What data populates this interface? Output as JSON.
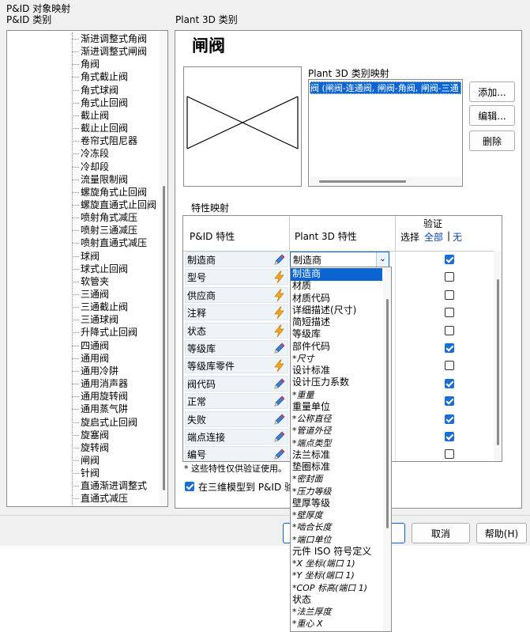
{
  "window": {
    "group_title": "P&ID 对象映射",
    "left_title": "P&ID 类别",
    "right_title": "Plant 3D 类别"
  },
  "tree": {
    "items": [
      "渐进调整式角阀",
      "渐进调整式闸阀",
      "角阀",
      "角式截止阀",
      "角式球阀",
      "角式止回阀",
      "截止阀",
      "截止止回阀",
      "卷帘式阻尼器",
      "冷冻段",
      "冷却段",
      "流量限制阀",
      "螺旋角式止回阀",
      "螺旋直通式止回阀",
      "喷射角式减压",
      "喷射三通减压",
      "喷射直通式减压",
      "球阀",
      "球式止回阀",
      "软管夹",
      "三通阀",
      "三通截止阀",
      "三通球阀",
      "升降式止回阀",
      "四通阀",
      "通用阀",
      "通用冷阱",
      "通用消声器",
      "通用旋转阀",
      "通用蒸气阱",
      "旋启式止回阀",
      "旋塞阀",
      "旋转阀",
      "闸阀",
      "针阀",
      "直通渐进调整式",
      "直通式减压"
    ],
    "selected_index": 33
  },
  "class_header": "闸阀",
  "mapping": {
    "label": "Plant 3D 类别映射",
    "entry": "阀 (闸阀-连通阀, 闸阀-角阀, 闸阀-三通",
    "add_btn": "添加...",
    "edit_btn": "编辑...",
    "delete_btn": "删除"
  },
  "props": {
    "section_label": "特性映射",
    "col_pid": "P&ID 特性",
    "col_p3d": "Plant 3D 特性",
    "col_verify": "验证",
    "select_label": "选择",
    "select_all": "全部",
    "select_sep": "|",
    "select_none": "无",
    "rows": [
      {
        "name": "制造商",
        "icon": "pencil-icon",
        "value": "制造商",
        "checked": true
      },
      {
        "name": "型号",
        "icon": "lightning-icon",
        "value": "",
        "checked": false
      },
      {
        "name": "供应商",
        "icon": "lightning-icon",
        "value": "",
        "checked": false
      },
      {
        "name": "注释",
        "icon": "lightning-icon",
        "value": "",
        "checked": false
      },
      {
        "name": "状态",
        "icon": "lightning-icon",
        "value": "",
        "checked": false
      },
      {
        "name": "等级库",
        "icon": "pencil-icon",
        "value": "",
        "checked": true
      },
      {
        "name": "等级库零件",
        "icon": "lightning-icon",
        "value": "",
        "checked": false
      },
      {
        "name": "阀代码",
        "icon": "pencil-icon",
        "value": "",
        "checked": true
      },
      {
        "name": "正常",
        "icon": "pencil-icon",
        "value": "",
        "checked": true
      },
      {
        "name": "失败",
        "icon": "pencil-icon",
        "value": "",
        "checked": true
      },
      {
        "name": "端点连接",
        "icon": "pencil-icon",
        "value": "",
        "checked": true
      },
      {
        "name": "编号",
        "icon": "pencil-icon",
        "value": "",
        "checked": false
      }
    ],
    "footnote": "* 这些特性仅供验证使用。",
    "check_label": "在三维模型到 P&ID 验"
  },
  "dropdown": {
    "items": [
      {
        "t": "制造商",
        "i": false
      },
      {
        "t": "材质",
        "i": false
      },
      {
        "t": "材质代码",
        "i": false
      },
      {
        "t": "详细描述(尺寸)",
        "i": false
      },
      {
        "t": "简短描述",
        "i": false
      },
      {
        "t": "等级库",
        "i": false
      },
      {
        "t": "部件代码",
        "i": false
      },
      {
        "t": "*尺寸",
        "i": true
      },
      {
        "t": "设计标准",
        "i": false
      },
      {
        "t": "设计压力系数",
        "i": false
      },
      {
        "t": "*重量",
        "i": true
      },
      {
        "t": "重量单位",
        "i": false
      },
      {
        "t": "*公称直径",
        "i": true
      },
      {
        "t": "*管道外径",
        "i": true
      },
      {
        "t": "*端点类型",
        "i": true
      },
      {
        "t": "法兰标准",
        "i": false
      },
      {
        "t": "垫圈标准",
        "i": false
      },
      {
        "t": "*密封面",
        "i": true
      },
      {
        "t": "*压力等级",
        "i": true
      },
      {
        "t": "壁厚等级",
        "i": false
      },
      {
        "t": "*壁厚度",
        "i": true
      },
      {
        "t": "*啮合长度",
        "i": true
      },
      {
        "t": "*端口单位",
        "i": true
      },
      {
        "t": "元件 ISO 符号定义",
        "i": false
      },
      {
        "t": "*X 坐标(端口 1)",
        "i": true
      },
      {
        "t": "*Y 坐标(端口 1)",
        "i": true
      },
      {
        "t": "*COP 标高(端口 1)",
        "i": true
      },
      {
        "t": "状态",
        "i": false
      },
      {
        "t": "*法兰厚度",
        "i": true
      },
      {
        "t": "*重心 X",
        "i": true
      }
    ],
    "selected_index": 0
  },
  "footer": {
    "cancel": "取消",
    "help": "帮助(H)"
  },
  "colors": {
    "accent": "#0a64d2",
    "link": "#0645ad",
    "lightning": "#f5a623",
    "pencil": "#3b7dd8"
  }
}
